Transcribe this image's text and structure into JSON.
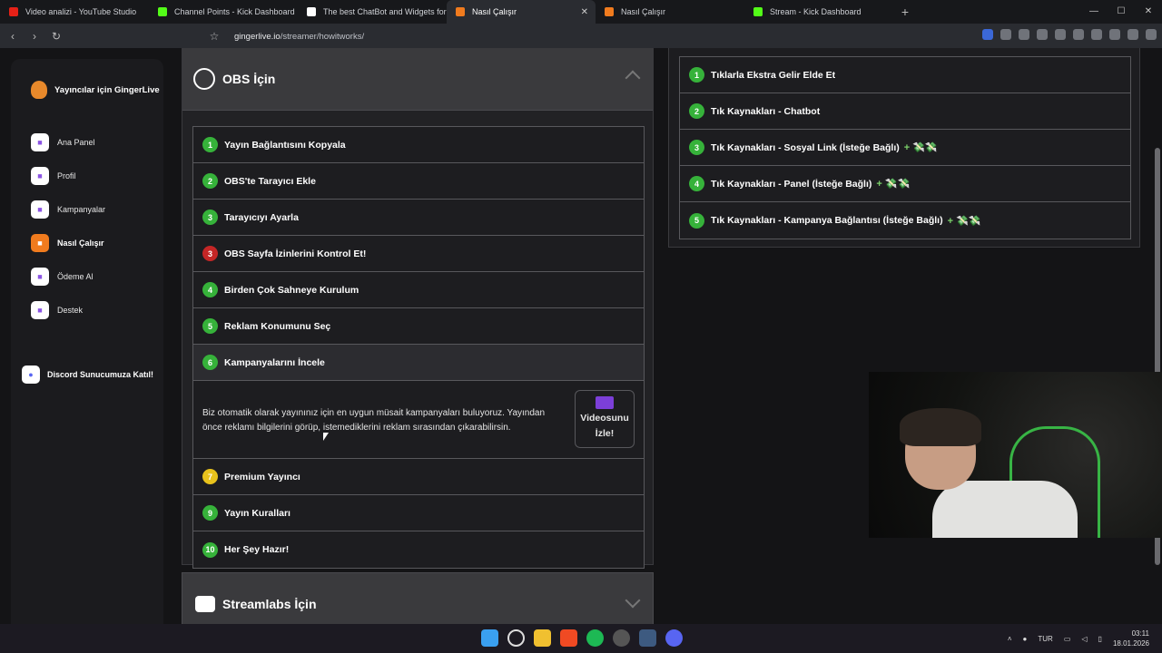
{
  "browser": {
    "tabs": [
      {
        "title": "Video analizi - YouTube Studio",
        "color": "#e62117",
        "active": false
      },
      {
        "title": "Channel Points - Kick Dashboard",
        "color": "#53fc18",
        "active": false
      },
      {
        "title": "The best ChatBot and Widgets for Kick",
        "color": "#ffffff",
        "active": false
      },
      {
        "title": "Nasıl Çalışır",
        "color": "#f07b1e",
        "active": true
      },
      {
        "title": "Nasıl Çalışır",
        "color": "#f07b1e",
        "active": false
      },
      {
        "title": "Stream - Kick Dashboard",
        "color": "#53fc18",
        "active": false
      }
    ],
    "url_domain": "gingerlive.io",
    "url_path": "/streamer/howitworks/"
  },
  "sidebar": {
    "brand": "Yayıncılar için GingerLive",
    "items": [
      {
        "label": "Ana Panel",
        "icon": "home-icon",
        "active": false
      },
      {
        "label": "Profil",
        "icon": "profile-icon",
        "active": false
      },
      {
        "label": "Kampanyalar",
        "icon": "rocket-icon",
        "active": false
      },
      {
        "label": "Nasıl Çalışır",
        "icon": "info-icon",
        "active": true
      },
      {
        "label": "Ödeme Al",
        "icon": "wallet-icon",
        "active": false
      },
      {
        "label": "Destek",
        "icon": "tools-icon",
        "active": false
      }
    ],
    "discord": "Discord Sunucumuza Katıl!"
  },
  "obs_panel": {
    "title": "OBS İçin",
    "steps": [
      {
        "num": "1",
        "label": "Yayın Bağlantısını Kopyala",
        "color": "green"
      },
      {
        "num": "2",
        "label": "OBS'te Tarayıcı Ekle",
        "color": "green"
      },
      {
        "num": "3",
        "label": "Tarayıcıyı Ayarla",
        "color": "green"
      },
      {
        "num": "3",
        "label": "OBS Sayfa İzinlerini Kontrol Et!",
        "color": "red"
      },
      {
        "num": "4",
        "label": "Birden Çok Sahneye Kurulum",
        "color": "green"
      },
      {
        "num": "5",
        "label": "Reklam Konumunu Seç",
        "color": "green"
      },
      {
        "num": "6",
        "label": "Kampanyalarını İncele",
        "color": "green"
      }
    ],
    "expanded_text": "Biz otomatik olarak yayınınız için en uygun müsait kampanyaları buluyoruz. Yayından önce reklamı bilgilerini görüp, istemediklerini reklam sırasından çıkarabilirsin.",
    "video_button": "Videosunu İzle!",
    "steps_after": [
      {
        "num": "7",
        "label": "Premium Yayıncı",
        "color": "yellow"
      },
      {
        "num": "9",
        "label": "Yayın Kuralları",
        "color": "green"
      },
      {
        "num": "10",
        "label": "Her Şey Hazır!",
        "color": "green"
      }
    ]
  },
  "streamlabs_panel": {
    "title": "Streamlabs İçin"
  },
  "right_panel": {
    "steps": [
      {
        "num": "1",
        "label": "Tıklarla Ekstra Gelir Elde Et",
        "money": false
      },
      {
        "num": "2",
        "label": "Tık Kaynakları - Chatbot",
        "money": false
      },
      {
        "num": "3",
        "label": "Tık Kaynakları - Sosyal Link (İsteğe Bağlı)",
        "money": true
      },
      {
        "num": "4",
        "label": "Tık Kaynakları - Panel (İsteğe Bağlı)",
        "money": true
      },
      {
        "num": "5",
        "label": "Tık Kaynakları - Kampanya Bağlantısı (İsteğe Bağlı)",
        "money": true
      }
    ],
    "money_suffix": "+ 💸💸"
  },
  "taskbar": {
    "lang": "TUR",
    "time": "03:11",
    "date": "18.01.2026"
  }
}
